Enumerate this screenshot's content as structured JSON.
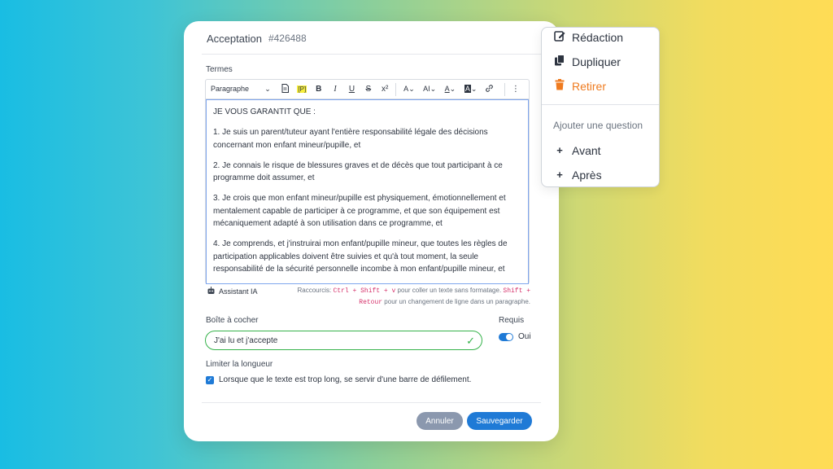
{
  "card": {
    "title": "Acceptation",
    "ticket": "#426488",
    "terms_label": "Termes",
    "toolbar": {
      "paragraph_select": "Paragraphe",
      "bold": "B",
      "italic": "I",
      "underline": "U",
      "strike": "S",
      "superscript": "x²",
      "placeholder_token": "[P]",
      "font_size": "A",
      "font_family": "AI",
      "text_color": "A",
      "bg_color": "A",
      "more": "⋮"
    },
    "content": [
      "JE VOUS GARANTIT QUE :",
      "1. Je suis un parent/tuteur ayant l'entière responsabilité légale des décisions concernant mon enfant mineur/pupille, et",
      "2. Je connais le risque de blessures graves et de décès que tout participant à ce programme doit assumer, et",
      "3. Je crois que mon enfant mineur/pupille est physiquement, émotionnellement et mentalement capable de participer à ce programme, et que son équipement est mécaniquement adapté à son utilisation dans ce programme, et",
      "4. Je comprends, et j'instruirai mon enfant/pupille mineur, que toutes les règles de participation applicables doivent être suivies et qu'à tout moment, la seule responsabilité de la sécurité personnelle incombe à mon enfant/pupille mineur, et"
    ],
    "assistant_label": "Assistant IA",
    "shortcut": {
      "prefix": "Raccourcis: ",
      "code1": "Ctrl + Shift + v",
      "mid": " pour coller un texte sans formatage. ",
      "code2": "Shift + Retour",
      "suffix": " pour un changement de ligne dans un paragraphe."
    },
    "checkbox_label": "Boîte à cocher",
    "checkbox_value": "J'ai lu et j'accepte",
    "required_label": "Requis",
    "required_value": "Oui",
    "limit_label": "Limiter la longueur",
    "limit_option": "Lorsque que le texte est trop long, se servir d'une barre de défilement.",
    "cancel_label": "Annuler",
    "save_label": "Sauvegarder"
  },
  "menu": {
    "edit": "Rédaction",
    "duplicate": "Dupliquer",
    "remove": "Retirer",
    "section": "Ajouter une question",
    "before": "Avant",
    "after": "Après"
  },
  "colors": {
    "accent": "#1f7ad6",
    "success": "#35b24a",
    "danger": "#ef7b1f",
    "cancel": "#8b98ae"
  },
  "icons": [
    "edit-icon",
    "copy-icon",
    "trash-icon",
    "plus-icon",
    "robot-icon",
    "check-icon",
    "link-icon",
    "document-icon"
  ]
}
